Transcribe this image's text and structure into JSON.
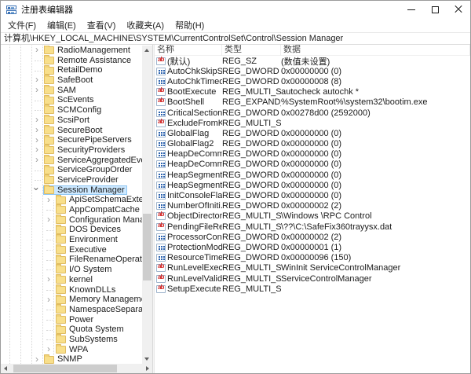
{
  "window": {
    "title": "注册表编辑器"
  },
  "menu": {
    "items": [
      "文件(F)",
      "编辑(E)",
      "查看(V)",
      "收藏夹(A)",
      "帮助(H)"
    ]
  },
  "address_bar": {
    "path": "计算机\\HKEY_LOCAL_MACHINE\\SYSTEM\\CurrentControlSet\\Control\\Session Manager"
  },
  "colors": {
    "selection_bg": "#cce8ff",
    "selection_border": "#8fc6f2",
    "folder_yellow": "#f8df8b",
    "string_icon_red": "#cf2020",
    "dword_icon_blue": "#2b62ae"
  },
  "tree": {
    "items": [
      {
        "label": "RadioManagement",
        "level": 0,
        "exp": "c"
      },
      {
        "label": "Remote Assistance",
        "level": 0,
        "exp": "n"
      },
      {
        "label": "RetailDemo",
        "level": 0,
        "exp": "n"
      },
      {
        "label": "SafeBoot",
        "level": 0,
        "exp": "c"
      },
      {
        "label": "SAM",
        "level": 0,
        "exp": "c"
      },
      {
        "label": "ScEvents",
        "level": 0,
        "exp": "n"
      },
      {
        "label": "SCMConfig",
        "level": 0,
        "exp": "n"
      },
      {
        "label": "ScsiPort",
        "level": 0,
        "exp": "c"
      },
      {
        "label": "SecureBoot",
        "level": 0,
        "exp": "c"
      },
      {
        "label": "SecurePipeServers",
        "level": 0,
        "exp": "c"
      },
      {
        "label": "SecurityProviders",
        "level": 0,
        "exp": "c"
      },
      {
        "label": "ServiceAggregatedEvents",
        "level": 0,
        "exp": "c"
      },
      {
        "label": "ServiceGroupOrder",
        "level": 0,
        "exp": "n"
      },
      {
        "label": "ServiceProvider",
        "level": 0,
        "exp": "n"
      },
      {
        "label": "Session Manager",
        "level": 0,
        "exp": "e",
        "selected": true
      },
      {
        "label": "ApiSetSchemaExtension",
        "level": 1,
        "exp": "c"
      },
      {
        "label": "AppCompatCache",
        "level": 1,
        "exp": "n"
      },
      {
        "label": "Configuration Manager",
        "level": 1,
        "exp": "c"
      },
      {
        "label": "DOS Devices",
        "level": 1,
        "exp": "n"
      },
      {
        "label": "Environment",
        "level": 1,
        "exp": "n"
      },
      {
        "label": "Executive",
        "level": 1,
        "exp": "n"
      },
      {
        "label": "FileRenameOperations",
        "level": 1,
        "exp": "n"
      },
      {
        "label": "I/O System",
        "level": 1,
        "exp": "n"
      },
      {
        "label": "kernel",
        "level": 1,
        "exp": "c"
      },
      {
        "label": "KnownDLLs",
        "level": 1,
        "exp": "n"
      },
      {
        "label": "Memory Management",
        "level": 1,
        "exp": "c"
      },
      {
        "label": "NamespaceSeparation",
        "level": 1,
        "exp": "n"
      },
      {
        "label": "Power",
        "level": 1,
        "exp": "n"
      },
      {
        "label": "Quota System",
        "level": 1,
        "exp": "n"
      },
      {
        "label": "SubSystems",
        "level": 1,
        "exp": "n"
      },
      {
        "label": "WPA",
        "level": 1,
        "exp": "c"
      },
      {
        "label": "SNMP",
        "level": 0,
        "exp": "c"
      }
    ]
  },
  "list": {
    "columns": [
      "名称",
      "类型",
      "数据"
    ],
    "rows": [
      {
        "icon": "string",
        "name": "(默认)",
        "type": "REG_SZ",
        "data": "(数值未设置)"
      },
      {
        "icon": "dword",
        "name": "AutoChkSkipSy...",
        "type": "REG_DWORD",
        "data": "0x00000000 (0)"
      },
      {
        "icon": "dword",
        "name": "AutoChkTimeout",
        "type": "REG_DWORD",
        "data": "0x00000008 (8)"
      },
      {
        "icon": "string",
        "name": "BootExecute",
        "type": "REG_MULTI_SZ",
        "data": "autocheck autochk *"
      },
      {
        "icon": "string",
        "name": "BootShell",
        "type": "REG_EXPAND_SZ",
        "data": "%SystemRoot%\\system32\\bootim.exe"
      },
      {
        "icon": "dword",
        "name": "CriticalSection...",
        "type": "REG_DWORD",
        "data": "0x00278d00 (2592000)"
      },
      {
        "icon": "string",
        "name": "ExcludeFromK...",
        "type": "REG_MULTI_SZ",
        "data": ""
      },
      {
        "icon": "dword",
        "name": "GlobalFlag",
        "type": "REG_DWORD",
        "data": "0x00000000 (0)"
      },
      {
        "icon": "dword",
        "name": "GlobalFlag2",
        "type": "REG_DWORD",
        "data": "0x00000000 (0)"
      },
      {
        "icon": "dword",
        "name": "HeapDeComm...",
        "type": "REG_DWORD",
        "data": "0x00000000 (0)"
      },
      {
        "icon": "dword",
        "name": "HeapDeComm...",
        "type": "REG_DWORD",
        "data": "0x00000000 (0)"
      },
      {
        "icon": "dword",
        "name": "HeapSegment...",
        "type": "REG_DWORD",
        "data": "0x00000000 (0)"
      },
      {
        "icon": "dword",
        "name": "HeapSegment...",
        "type": "REG_DWORD",
        "data": "0x00000000 (0)"
      },
      {
        "icon": "dword",
        "name": "InitConsoleFlags",
        "type": "REG_DWORD",
        "data": "0x00000000 (0)"
      },
      {
        "icon": "dword",
        "name": "NumberOfIniti...",
        "type": "REG_DWORD",
        "data": "0x00000002 (2)"
      },
      {
        "icon": "string",
        "name": "ObjectDirector...",
        "type": "REG_MULTI_SZ",
        "data": "\\Windows \\RPC Control"
      },
      {
        "icon": "string",
        "name": "PendingFileRe...",
        "type": "REG_MULTI_SZ",
        "data": "\\??\\C:\\SafeFix360trayysx.dat"
      },
      {
        "icon": "dword",
        "name": "ProcessorCont...",
        "type": "REG_DWORD",
        "data": "0x00000002 (2)"
      },
      {
        "icon": "dword",
        "name": "ProtectionMode",
        "type": "REG_DWORD",
        "data": "0x00000001 (1)"
      },
      {
        "icon": "dword",
        "name": "ResourceTime...",
        "type": "REG_DWORD",
        "data": "0x00000096 (150)"
      },
      {
        "icon": "string",
        "name": "RunLevelExecute",
        "type": "REG_MULTI_SZ",
        "data": "WinInit ServiceControlManager"
      },
      {
        "icon": "string",
        "name": "RunLevelValida...",
        "type": "REG_MULTI_SZ",
        "data": "ServiceControlManager"
      },
      {
        "icon": "string",
        "name": "SetupExecute",
        "type": "REG_MULTI_SZ",
        "data": ""
      }
    ]
  }
}
